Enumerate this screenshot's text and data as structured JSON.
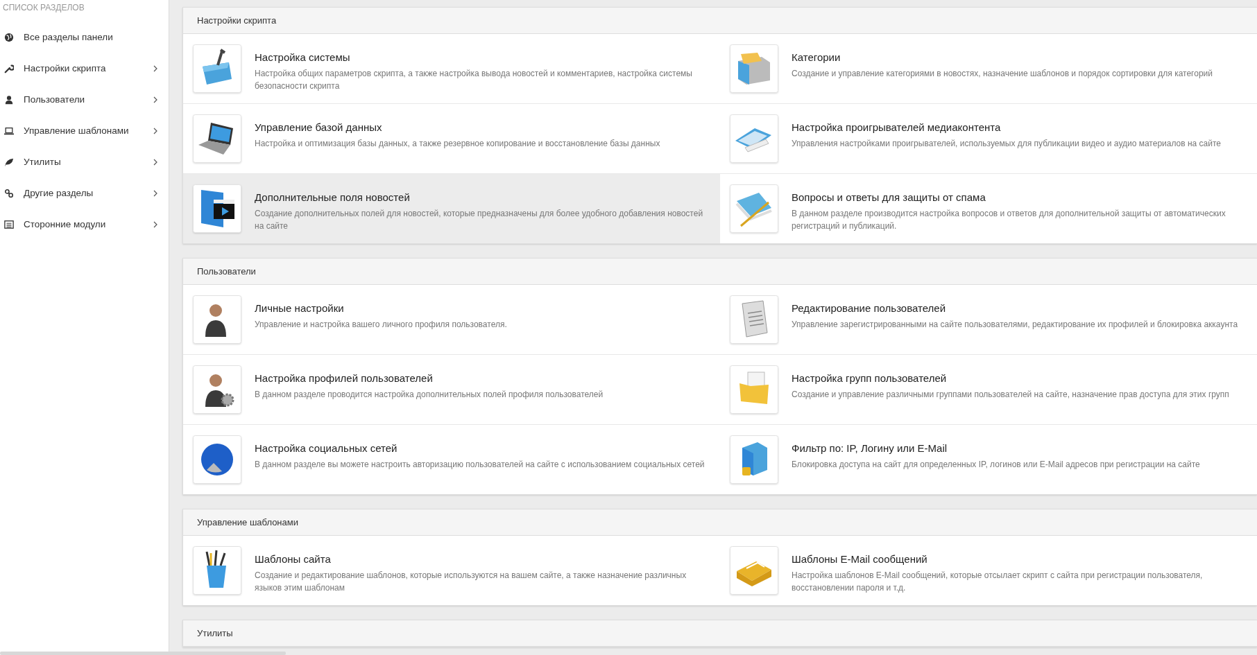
{
  "sidebar": {
    "heading": "СПИСОК РАЗДЕЛОВ",
    "items": [
      {
        "label": "Все разделы панели",
        "has_submenu": false
      },
      {
        "label": "Настройки скрипта",
        "has_submenu": true
      },
      {
        "label": "Пользователи",
        "has_submenu": true
      },
      {
        "label": "Управление шаблонами",
        "has_submenu": true
      },
      {
        "label": "Утилиты",
        "has_submenu": true
      },
      {
        "label": "Другие разделы",
        "has_submenu": true
      },
      {
        "label": "Сторонние модули",
        "has_submenu": true
      }
    ]
  },
  "sections": [
    {
      "title": "Настройки скрипта",
      "items": [
        {
          "title": "Настройка системы",
          "description": "Настройка общих параметров скрипта, а также настройка вывода новостей и комментариев, настройка системы безопасности скрипта",
          "highlighted": false
        },
        {
          "title": "Категории",
          "description": "Создание и управление категориями в новостях, назначение шаблонов и порядок сортировки для категорий",
          "highlighted": false
        },
        {
          "title": "Управление базой данных",
          "description": "Настройка и оптимизация базы данных, а также резервное копирование и восстановление базы данных",
          "highlighted": false
        },
        {
          "title": "Настройка проигрывателей медиаконтента",
          "description": "Управления настройками проигрывателей, используемых для публикации видео и аудио материалов на сайте",
          "highlighted": false
        },
        {
          "title": "Дополнительные поля новостей",
          "description": "Создание дополнительных полей для новостей, которые предназначены для более удобного добавления новостей на сайте",
          "highlighted": true
        },
        {
          "title": "Вопросы и ответы для защиты от спама",
          "description": "В данном разделе производится настройка вопросов и ответов для дополнительной защиты от автоматических регистраций и публикаций.",
          "highlighted": false
        }
      ]
    },
    {
      "title": "Пользователи",
      "items": [
        {
          "title": "Личные настройки",
          "description": "Управление и настройка вашего личного профиля пользователя.",
          "highlighted": false
        },
        {
          "title": "Редактирование пользователей",
          "description": "Управление зарегистрированными на сайте пользователями, редактирование их профилей и блокировка аккаунта",
          "highlighted": false
        },
        {
          "title": "Настройка профилей пользователей",
          "description": "В данном разделе проводится настройка дополнительных полей профиля пользователей",
          "highlighted": false
        },
        {
          "title": "Настройка групп пользователей",
          "description": "Создание и управление различными группами пользователей на сайте, назначение прав доступа для этих групп",
          "highlighted": false
        },
        {
          "title": "Настройка социальных сетей",
          "description": "В данном разделе вы можете настроить авторизацию пользователей на сайте с использованием социальных сетей",
          "highlighted": false
        },
        {
          "title": "Фильтр по: IP, Логину или E-Mail",
          "description": "Блокировка доступа на сайт для определенных IP, логинов или E-Mail адресов при регистрации на сайте",
          "highlighted": false
        }
      ]
    },
    {
      "title": "Управление шаблонами",
      "items": [
        {
          "title": "Шаблоны сайта",
          "description": "Создание и редактирование шаблонов, которые используются на вашем сайте, а также назначение различных языков этим шаблонам",
          "highlighted": false
        },
        {
          "title": "Шаблоны E-Mail сообщений",
          "description": "Настройка шаблонов E-Mail сообщений, которые отсылает скрипт с сайта при регистрации пользователя, восстановлении пароля и т.д.",
          "highlighted": false
        }
      ]
    },
    {
      "title": "Утилиты"
    }
  ]
}
